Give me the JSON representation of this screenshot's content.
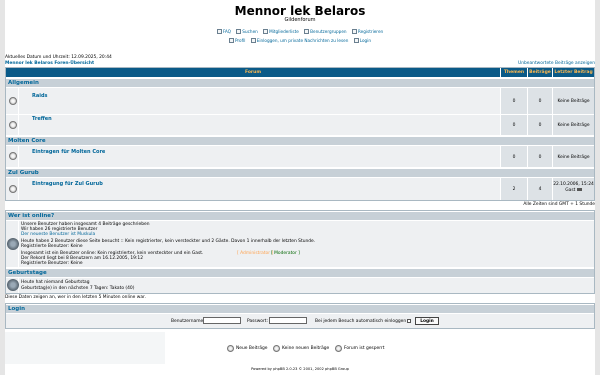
{
  "site": {
    "title": "Mennor lek Belaros",
    "subtitle": "Gildenforum"
  },
  "nav": {
    "row1": [
      {
        "label": "FAQ",
        "icon": "faq-icon"
      },
      {
        "label": "Suchen",
        "icon": "search-icon"
      },
      {
        "label": "Mitgliederliste",
        "icon": "memberlist-icon"
      },
      {
        "label": "Benutzergruppen",
        "icon": "usergroups-icon"
      },
      {
        "label": "Registrieren",
        "icon": "register-icon"
      }
    ],
    "row2": [
      {
        "label": "Profil",
        "icon": "profile-icon"
      },
      {
        "label": "Einloggen, um private Nachrichten zu lesen",
        "icon": "messages-icon"
      },
      {
        "label": "Login",
        "icon": "login-icon"
      }
    ]
  },
  "info": {
    "datetime": "Aktuelles Datum und Uhrzeit: 12.09.2025, 20:44",
    "overview": "Mennor lek Belaros Foren-Übersicht",
    "unanswered": "Unbeantwortete Beiträge anzeigen"
  },
  "table": {
    "headers": {
      "forum": "Forum",
      "topics": "Themen",
      "posts": "Beiträge",
      "last": "Letzter Beitrag"
    },
    "categories": [
      {
        "name": "Allgemein",
        "forums": [
          {
            "name": "Raids",
            "topics": "0",
            "posts": "0",
            "last": "Keine Beiträge"
          },
          {
            "name": "Treffen",
            "topics": "0",
            "posts": "0",
            "last": "Keine Beiträge"
          }
        ]
      },
      {
        "name": "Molten Core",
        "forums": [
          {
            "name": "Eintragen für Molten Core",
            "topics": "0",
            "posts": "0",
            "last": "Keine Beiträge"
          }
        ]
      },
      {
        "name": "Zul Gurub",
        "forums": [
          {
            "name": "Eintragung für Zul Gurub",
            "topics": "2",
            "posts": "4",
            "last": "22.10.2006, 15:24",
            "last_user": "Gast"
          }
        ]
      }
    ],
    "timezone": "Alle Zeiten sind GMT + 1 Stunde"
  },
  "online": {
    "title": "Wer ist online?",
    "stats": [
      "Unsere Benutzer haben insgesamt 4 Beiträge geschrieben",
      "Wir haben 26 registrierte Benutzer",
      "Der neueste Benutzer ist Muskula"
    ],
    "today": [
      "Heute haben 2 Benutzer diese Seite besucht :: Kein registrierter, kein versteckter und 2 Gäste. Davon 1 innerhalb der letzten Stunde.",
      "Registrierte Benutzer: Keine"
    ],
    "now": [
      "Insgesamt ist ein Benutzer online: Kein registrierter, kein versteckter und ein Gast.",
      "Der Rekord liegt bei 8 Benutzern am 16.12.2005, 19:12",
      "Registrierte Benutzer: Keine"
    ],
    "admin": "Administrator",
    "moderator": "Moderator",
    "admin_color": "#ffa34f",
    "moderator_color": "#006600"
  },
  "birthdays": {
    "title": "Geburtstage",
    "lines": [
      "Heute hat niemand Geburtstag",
      "Geburtstag(e) in den nächsten 7 Tagen: Takato (40)"
    ]
  },
  "footer_note": "Diese Daten zeigen an, wer in den letzten 5 Minuten online war.",
  "login": {
    "title": "Login",
    "username_label": "Benutzername:",
    "password_label": "Passwort:",
    "auto_label": "Bei jedem Besuch automatisch einloggen",
    "button": "Login"
  },
  "legend": [
    {
      "label": "Neue Beiträge",
      "icon": "new-posts-icon"
    },
    {
      "label": "Keine neuen Beiträge",
      "icon": "no-new-posts-icon"
    },
    {
      "label": "Forum ist gesperrt",
      "icon": "locked-forum-icon"
    }
  ],
  "powered": "Powered by phpBB 2.0.23 © 2001, 2002 phpBB Group",
  "colors": {
    "header": "#0a5a88",
    "header_text": "#ffb84e",
    "link": "#006699",
    "category": "#c7d0d7"
  }
}
